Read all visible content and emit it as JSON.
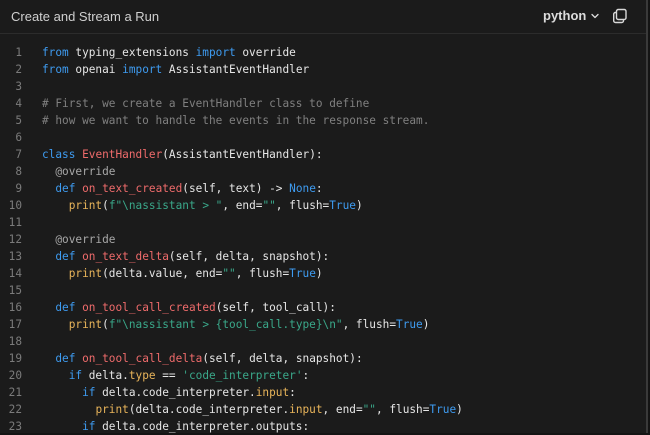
{
  "header": {
    "title": "Create and Stream a Run",
    "language": "python"
  },
  "code": {
    "lines": [
      {
        "n": "1",
        "t": [
          {
            "c": "kw",
            "s": "from"
          },
          {
            "c": "",
            "s": " typing_extensions "
          },
          {
            "c": "kw",
            "s": "import"
          },
          {
            "c": "",
            "s": " override"
          }
        ]
      },
      {
        "n": "2",
        "t": [
          {
            "c": "kw",
            "s": "from"
          },
          {
            "c": "",
            "s": " openai "
          },
          {
            "c": "kw",
            "s": "import"
          },
          {
            "c": "",
            "s": " AssistantEventHandler"
          }
        ]
      },
      {
        "n": "3",
        "t": []
      },
      {
        "n": "4",
        "t": [
          {
            "c": "com",
            "s": "# First, we create a EventHandler class to define"
          }
        ]
      },
      {
        "n": "5",
        "t": [
          {
            "c": "com",
            "s": "# how we want to handle the events in the response stream."
          }
        ]
      },
      {
        "n": "6",
        "t": []
      },
      {
        "n": "7",
        "t": [
          {
            "c": "kw",
            "s": "class"
          },
          {
            "c": "",
            "s": " "
          },
          {
            "c": "fn",
            "s": "EventHandler"
          },
          {
            "c": "",
            "s": "(AssistantEventHandler):"
          }
        ]
      },
      {
        "n": "8",
        "t": [
          {
            "c": "",
            "s": "  "
          },
          {
            "c": "dec",
            "s": "@override"
          }
        ]
      },
      {
        "n": "9",
        "t": [
          {
            "c": "",
            "s": "  "
          },
          {
            "c": "kw",
            "s": "def"
          },
          {
            "c": "",
            "s": " "
          },
          {
            "c": "fn",
            "s": "on_text_created"
          },
          {
            "c": "",
            "s": "(self, text) -> "
          },
          {
            "c": "const",
            "s": "None"
          },
          {
            "c": "",
            "s": ":"
          }
        ]
      },
      {
        "n": "10",
        "t": [
          {
            "c": "",
            "s": "    "
          },
          {
            "c": "bi",
            "s": "print"
          },
          {
            "c": "",
            "s": "("
          },
          {
            "c": "str",
            "s": "f\"\\nassistant > \""
          },
          {
            "c": "",
            "s": ", end="
          },
          {
            "c": "str",
            "s": "\"\""
          },
          {
            "c": "",
            "s": ", flush="
          },
          {
            "c": "const",
            "s": "True"
          },
          {
            "c": "",
            "s": ")"
          }
        ]
      },
      {
        "n": "11",
        "t": []
      },
      {
        "n": "12",
        "t": [
          {
            "c": "",
            "s": "  "
          },
          {
            "c": "dec",
            "s": "@override"
          }
        ]
      },
      {
        "n": "13",
        "t": [
          {
            "c": "",
            "s": "  "
          },
          {
            "c": "kw",
            "s": "def"
          },
          {
            "c": "",
            "s": " "
          },
          {
            "c": "fn",
            "s": "on_text_delta"
          },
          {
            "c": "",
            "s": "(self, delta, snapshot):"
          }
        ]
      },
      {
        "n": "14",
        "t": [
          {
            "c": "",
            "s": "    "
          },
          {
            "c": "bi",
            "s": "print"
          },
          {
            "c": "",
            "s": "(delta.value, end="
          },
          {
            "c": "str",
            "s": "\"\""
          },
          {
            "c": "",
            "s": ", flush="
          },
          {
            "c": "const",
            "s": "True"
          },
          {
            "c": "",
            "s": ")"
          }
        ]
      },
      {
        "n": "15",
        "t": []
      },
      {
        "n": "16",
        "t": [
          {
            "c": "",
            "s": "  "
          },
          {
            "c": "kw",
            "s": "def"
          },
          {
            "c": "",
            "s": " "
          },
          {
            "c": "fn",
            "s": "on_tool_call_created"
          },
          {
            "c": "",
            "s": "(self, tool_call):"
          }
        ]
      },
      {
        "n": "17",
        "t": [
          {
            "c": "",
            "s": "    "
          },
          {
            "c": "bi",
            "s": "print"
          },
          {
            "c": "",
            "s": "("
          },
          {
            "c": "str",
            "s": "f\"\\nassistant > {tool_call.type}\\n\""
          },
          {
            "c": "",
            "s": ", flush="
          },
          {
            "c": "const",
            "s": "True"
          },
          {
            "c": "",
            "s": ")"
          }
        ]
      },
      {
        "n": "18",
        "t": []
      },
      {
        "n": "19",
        "t": [
          {
            "c": "",
            "s": "  "
          },
          {
            "c": "kw",
            "s": "def"
          },
          {
            "c": "",
            "s": " "
          },
          {
            "c": "fn",
            "s": "on_tool_call_delta"
          },
          {
            "c": "",
            "s": "(self, delta, snapshot):"
          }
        ]
      },
      {
        "n": "20",
        "t": [
          {
            "c": "",
            "s": "    "
          },
          {
            "c": "kw",
            "s": "if"
          },
          {
            "c": "",
            "s": " delta."
          },
          {
            "c": "attr",
            "s": "type"
          },
          {
            "c": "",
            "s": " == "
          },
          {
            "c": "str",
            "s": "'code_interpreter'"
          },
          {
            "c": "",
            "s": ":"
          }
        ]
      },
      {
        "n": "21",
        "t": [
          {
            "c": "",
            "s": "      "
          },
          {
            "c": "kw",
            "s": "if"
          },
          {
            "c": "",
            "s": " delta.code_interpreter."
          },
          {
            "c": "attr",
            "s": "input"
          },
          {
            "c": "",
            "s": ":"
          }
        ]
      },
      {
        "n": "22",
        "t": [
          {
            "c": "",
            "s": "        "
          },
          {
            "c": "bi",
            "s": "print"
          },
          {
            "c": "",
            "s": "(delta.code_interpreter."
          },
          {
            "c": "attr",
            "s": "input"
          },
          {
            "c": "",
            "s": ", end="
          },
          {
            "c": "str",
            "s": "\"\""
          },
          {
            "c": "",
            "s": ", flush="
          },
          {
            "c": "const",
            "s": "True"
          },
          {
            "c": "",
            "s": ")"
          }
        ]
      },
      {
        "n": "23",
        "t": [
          {
            "c": "",
            "s": "      "
          },
          {
            "c": "kw",
            "s": "if"
          },
          {
            "c": "",
            "s": " delta.code_interpreter.outputs:"
          }
        ]
      }
    ]
  },
  "colors": {
    "background": "#1b1b1b",
    "keyword": "#3e9bf0",
    "function": "#ef6b6b",
    "string": "#3aa88a",
    "comment": "#808080"
  }
}
